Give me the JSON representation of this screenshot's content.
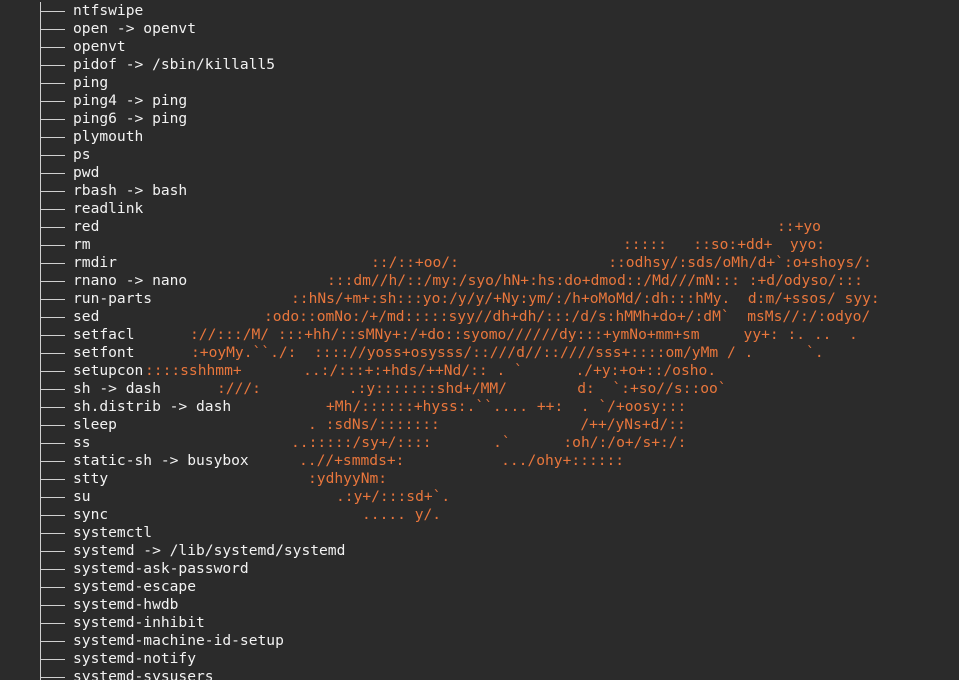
{
  "terminal": {
    "colors": {
      "background": "#2b2b2b",
      "text": "#f2f2f2",
      "art": "#e8763c",
      "tree": "#d0d0d0"
    },
    "tree_lines": [
      {
        "name": "ntfswipe",
        "art": ""
      },
      {
        "name": "open -> openvt",
        "art": ""
      },
      {
        "name": "openvt",
        "art": ""
      },
      {
        "name": "pidof -> /sbin/killall5",
        "art": ""
      },
      {
        "name": "ping",
        "art": ""
      },
      {
        "name": "ping4 -> ping",
        "art": ""
      },
      {
        "name": "ping6 -> ping",
        "art": ""
      },
      {
        "name": "plymouth",
        "art": ""
      },
      {
        "name": "ps",
        "art": ""
      },
      {
        "name": "pwd",
        "art": ""
      },
      {
        "name": "rbash -> bash",
        "art": ""
      },
      {
        "name": "readlink",
        "art": ""
      },
      {
        "name": "red",
        "art": "::+yo"
      },
      {
        "name": "rm",
        "art": ":::::   ::so:+dd+  yyo:"
      },
      {
        "name": "rmdir",
        "art": "::/::+oo/:                 ::odhsy/:sds/oMh/d+`:o+shoys/:"
      },
      {
        "name": "rnano -> nano",
        "art": ":::dm//h/::/my:/syo/hN+:hs:do+dmod::/Md///mN::: :+d/odyso/:::"
      },
      {
        "name": "run-parts",
        "art": "::hNs/+m+:sh:::yo:/y/y/+Ny:ym/:/h+oMoMd/:dh:::hMy.  d:m/+ssos/ syy:"
      },
      {
        "name": "sed",
        "art": ":odo::omNo:/+/md:::::syy//dh+dh/:::/d/s:hMMh+do+/:dM`  msMs//:/:odyo/"
      },
      {
        "name": "setfacl",
        "art": "://:::/M/ :::+hh/::sMNy+:/+do::syomo//////dy:::+ymNo+mm+sm     yy+: :. ..  ."
      },
      {
        "name": "setfont",
        "art": ":+oyMy.``./:  :::://yoss+osysss/::///d//::////sss+::::om/yMm / .      `."
      },
      {
        "name": "setupcon",
        "art": "::::sshhmm+       ..:/:::+:+hds/++Nd/:: . `      ./+y:+o+::/osho."
      },
      {
        "name": "sh -> dash",
        "art": ":///:          .:y:::::::shd+/MM/        d:  `:+so//s::oo`"
      },
      {
        "name": "sh.distrib -> dash",
        "art": "+Mh/::::::+hyss:.``.... ++:  . `/+oosy:::"
      },
      {
        "name": "sleep",
        "art": ". :sdNs/:::::::                /++/yNs+d/::"
      },
      {
        "name": "ss",
        "art": "..:::::/sy+/::::       .`      :oh/:/o+/s+:/:"
      },
      {
        "name": "static-sh -> busybox",
        "art": "..//+smmds+:           .../ohy+::::::"
      },
      {
        "name": "stty",
        "art": ":ydhyyNm:"
      },
      {
        "name": "su",
        "art": ".:y+/:::sd+`."
      },
      {
        "name": "sync",
        "art": "..... y/."
      },
      {
        "name": "systemctl",
        "art": ""
      },
      {
        "name": "systemd -> /lib/systemd/systemd",
        "art": ""
      },
      {
        "name": "systemd-ask-password",
        "art": ""
      },
      {
        "name": "systemd-escape",
        "art": ""
      },
      {
        "name": "systemd-hwdb",
        "art": ""
      },
      {
        "name": "systemd-inhibit",
        "art": ""
      },
      {
        "name": "systemd-machine-id-setup",
        "art": ""
      },
      {
        "name": "systemd-notify",
        "art": ""
      },
      {
        "name": "systemd-sysusers",
        "art": ""
      }
    ]
  }
}
